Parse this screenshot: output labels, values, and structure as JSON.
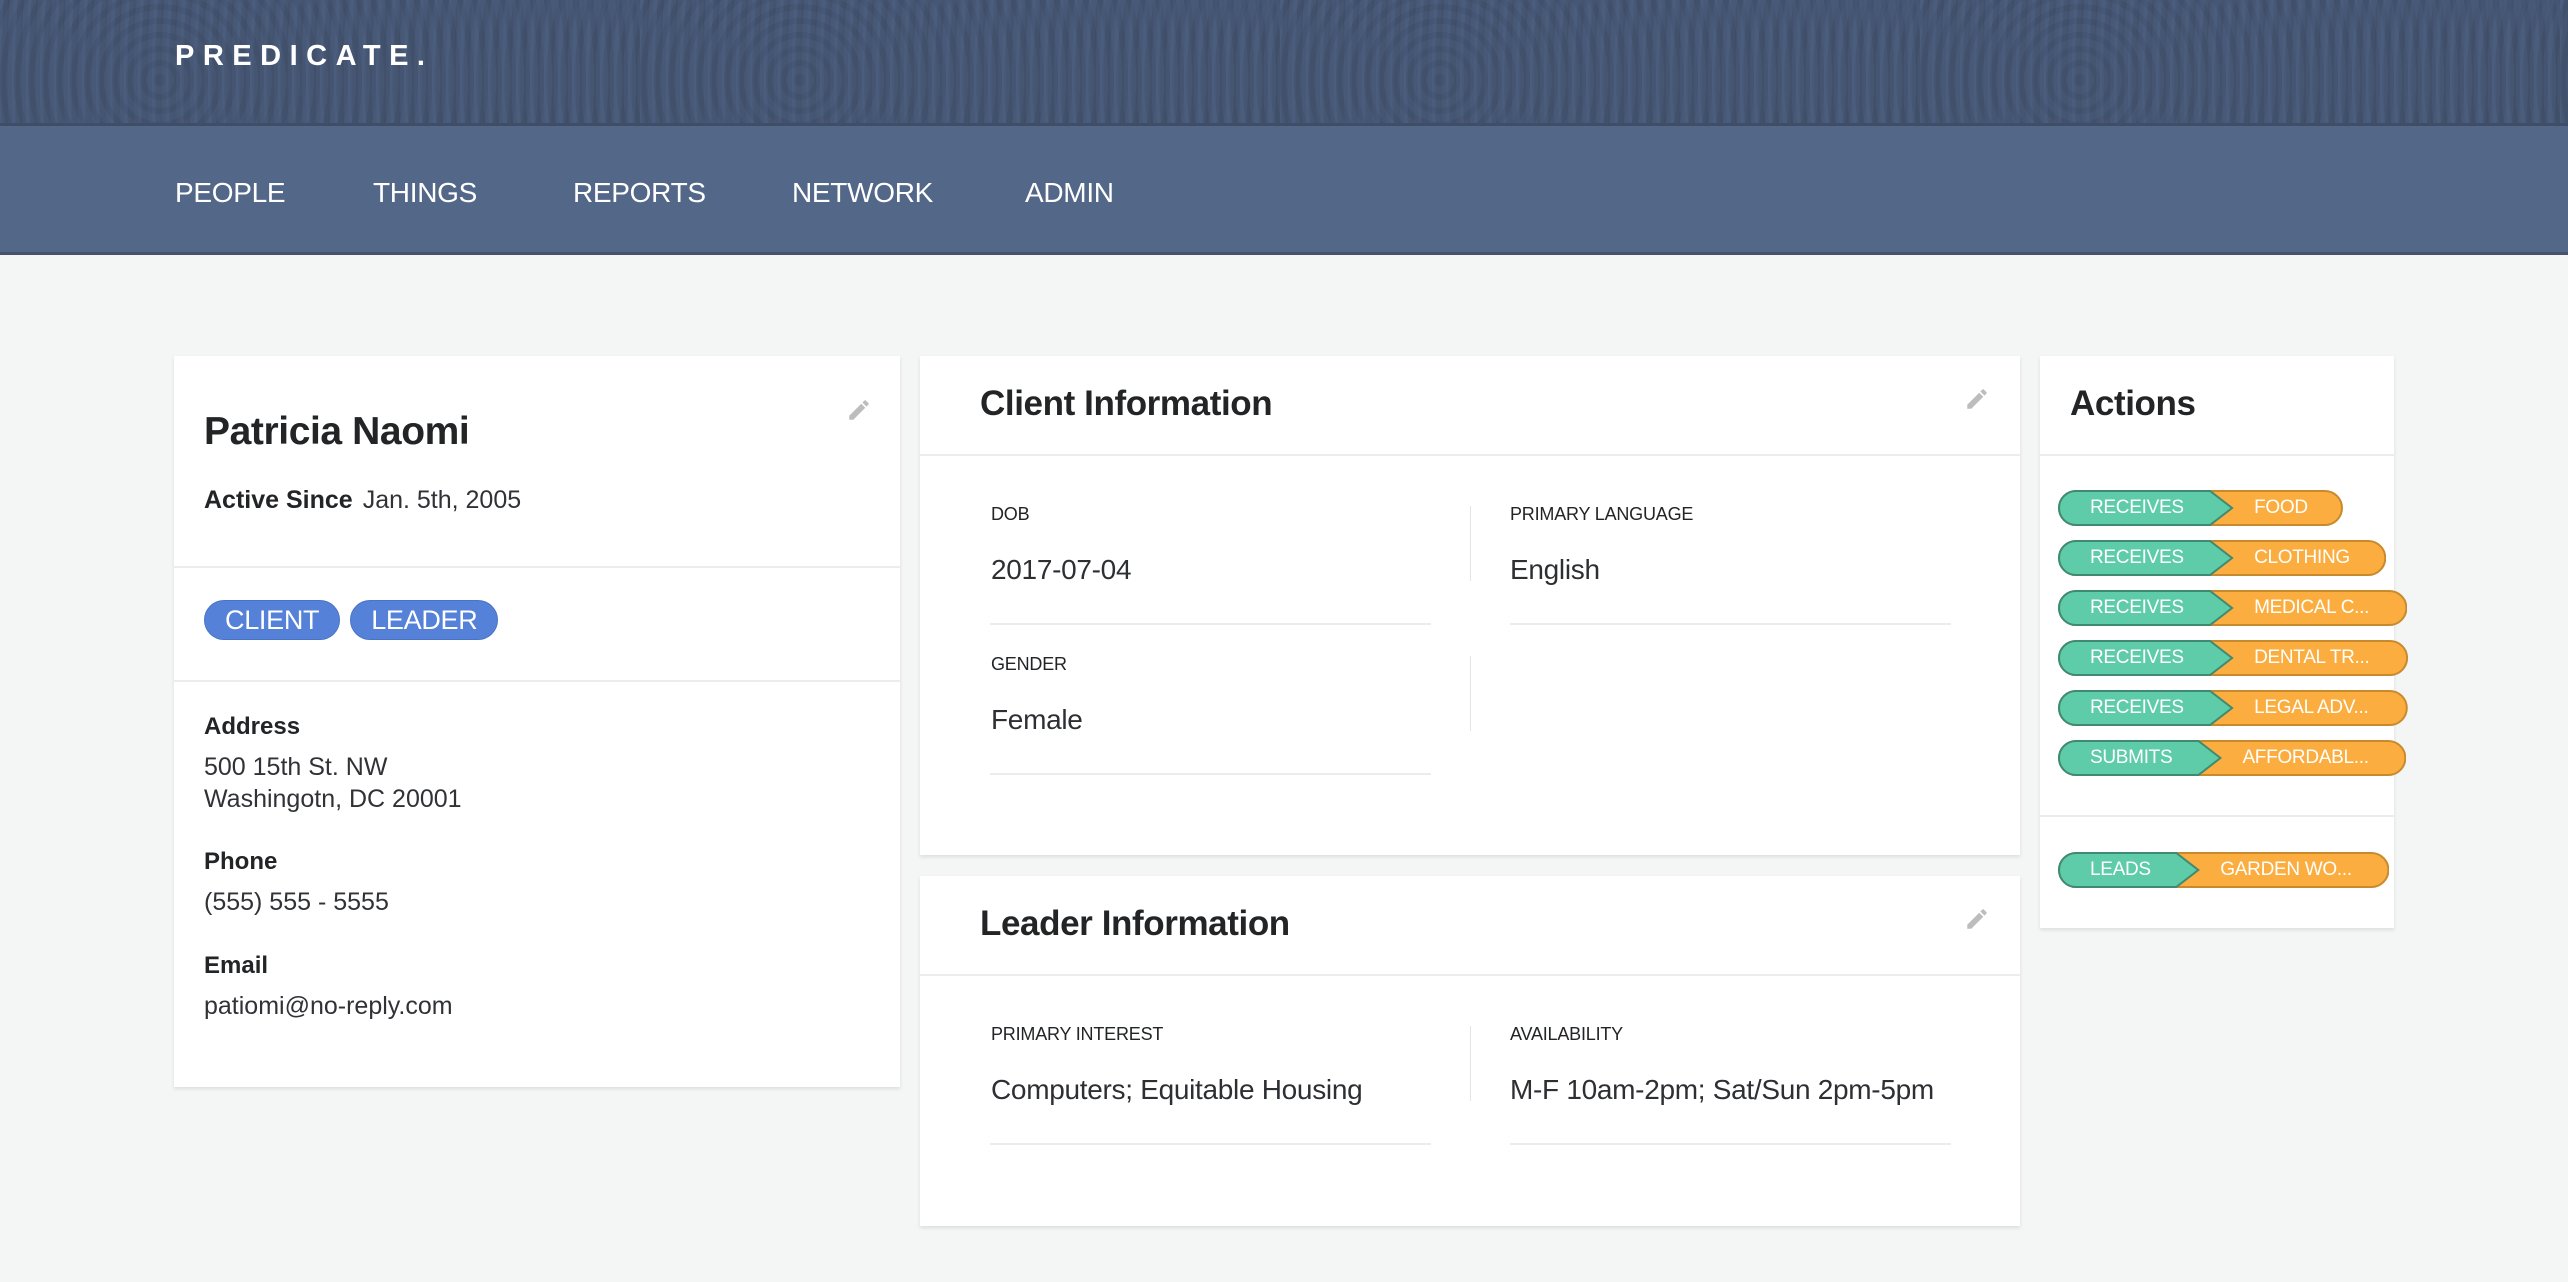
{
  "app": {
    "logo": "PREDICATE."
  },
  "nav": {
    "items": [
      {
        "label": "PEOPLE"
      },
      {
        "label": "THINGS"
      },
      {
        "label": "REPORTS"
      },
      {
        "label": "NETWORK"
      },
      {
        "label": "ADMIN"
      }
    ]
  },
  "profile": {
    "name": "Patricia Naomi",
    "active_since_label": "Active Since",
    "active_since_value": "Jan. 5th, 2005",
    "edit_icon": "pencil-icon",
    "tags": [
      {
        "label": "CLIENT"
      },
      {
        "label": "LEADER"
      }
    ],
    "address_label": "Address",
    "address_line1": "500 15th St. NW",
    "address_line2": "Washingotn, DC 20001",
    "phone_label": "Phone",
    "phone_value": "(555) 555 - 5555",
    "email_label": "Email",
    "email_value": "patiomi@no-reply.com"
  },
  "client_info": {
    "title": "Client Information",
    "edit_icon": "pencil-icon",
    "fields": [
      {
        "label": "DOB",
        "value": "2017-07-04"
      },
      {
        "label": "PRIMARY LANGUAGE",
        "value": "English"
      },
      {
        "label": "GENDER",
        "value": "Female"
      }
    ]
  },
  "leader_info": {
    "title": "Leader Information",
    "edit_icon": "pencil-icon",
    "fields": [
      {
        "label": "PRIMARY INTEREST",
        "value": "Computers; Equitable Housing"
      },
      {
        "label": "AVAILABILITY",
        "value": "M-F 10am-2pm; Sat/Sun 2pm-5pm"
      }
    ]
  },
  "actions": {
    "title": "Actions",
    "groups": [
      {
        "items": [
          {
            "verb": "RECEIVES",
            "object": "FOOD"
          },
          {
            "verb": "RECEIVES",
            "object": "CLOTHING"
          },
          {
            "verb": "RECEIVES",
            "object": "MEDICAL C..."
          },
          {
            "verb": "RECEIVES",
            "object": "DENTAL TR..."
          },
          {
            "verb": "RECEIVES",
            "object": "LEGAL ADV..."
          },
          {
            "verb": "SUBMITS",
            "object": "AFFORDABL..."
          }
        ]
      },
      {
        "items": [
          {
            "verb": "LEADS",
            "object": "GARDEN WO..."
          }
        ]
      }
    ]
  },
  "colors": {
    "header_bg": "#4b5d7c",
    "nav_bg": "#536789",
    "page_bg": "#f4f6f6",
    "tag_blue": "#5582d8",
    "verb_teal": "#5ecba9",
    "verb_teal_border": "#3f8a73",
    "object_orange": "#fbad3f",
    "object_orange_border": "#c98a2e",
    "icon_gray": "#bdbdbd"
  }
}
